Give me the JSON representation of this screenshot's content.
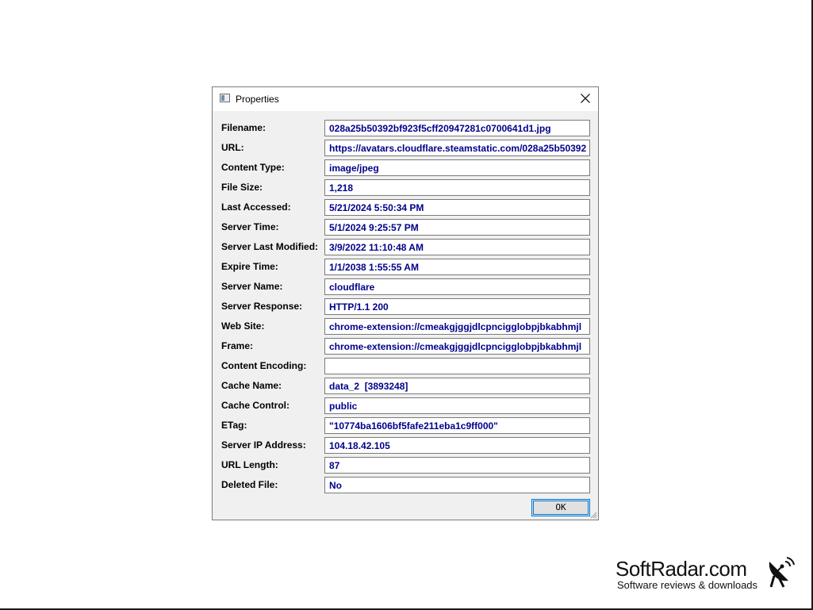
{
  "dialog": {
    "title": "Properties",
    "close_icon": "close-x-icon",
    "ok_label": "OK"
  },
  "properties": [
    {
      "label": "Filename:",
      "value": "028a25b50392bf923f5cff20947281c0700641d1.jpg"
    },
    {
      "label": "URL:",
      "value": "https://avatars.cloudflare.steamstatic.com/028a25b50392"
    },
    {
      "label": "Content Type:",
      "value": "image/jpeg"
    },
    {
      "label": "File Size:",
      "value": "1,218"
    },
    {
      "label": "Last Accessed:",
      "value": "5/21/2024 5:50:34 PM"
    },
    {
      "label": "Server Time:",
      "value": "5/1/2024 9:25:57 PM"
    },
    {
      "label": "Server Last Modified:",
      "value": "3/9/2022 11:10:48 AM"
    },
    {
      "label": "Expire Time:",
      "value": "1/1/2038 1:55:55 AM"
    },
    {
      "label": "Server Name:",
      "value": "cloudflare"
    },
    {
      "label": "Server Response:",
      "value": "HTTP/1.1 200"
    },
    {
      "label": "Web Site:",
      "value": "chrome-extension://cmeakgjggjdlcpncigglobpjbkabhmjl"
    },
    {
      "label": "Frame:",
      "value": "chrome-extension://cmeakgjggjdlcpncigglobpjbkabhmjl"
    },
    {
      "label": "Content Encoding:",
      "value": ""
    },
    {
      "label": "Cache Name:",
      "value": "data_2  [3893248]"
    },
    {
      "label": "Cache Control:",
      "value": "public"
    },
    {
      "label": "ETag:",
      "value": "\"10774ba1606bf5fafe211eba1c9ff000\""
    },
    {
      "label": "Server IP Address:",
      "value": "104.18.42.105"
    },
    {
      "label": "URL Length:",
      "value": "87"
    },
    {
      "label": "Deleted File:",
      "value": "No"
    }
  ],
  "watermark": {
    "name": "SoftRadar.com",
    "tagline": "Software reviews & downloads",
    "icon": "satellite-dish-icon"
  },
  "colors": {
    "value_text": "#00008b",
    "dialog_bg": "#f0f0f0",
    "focus_accent": "#0078d7"
  }
}
